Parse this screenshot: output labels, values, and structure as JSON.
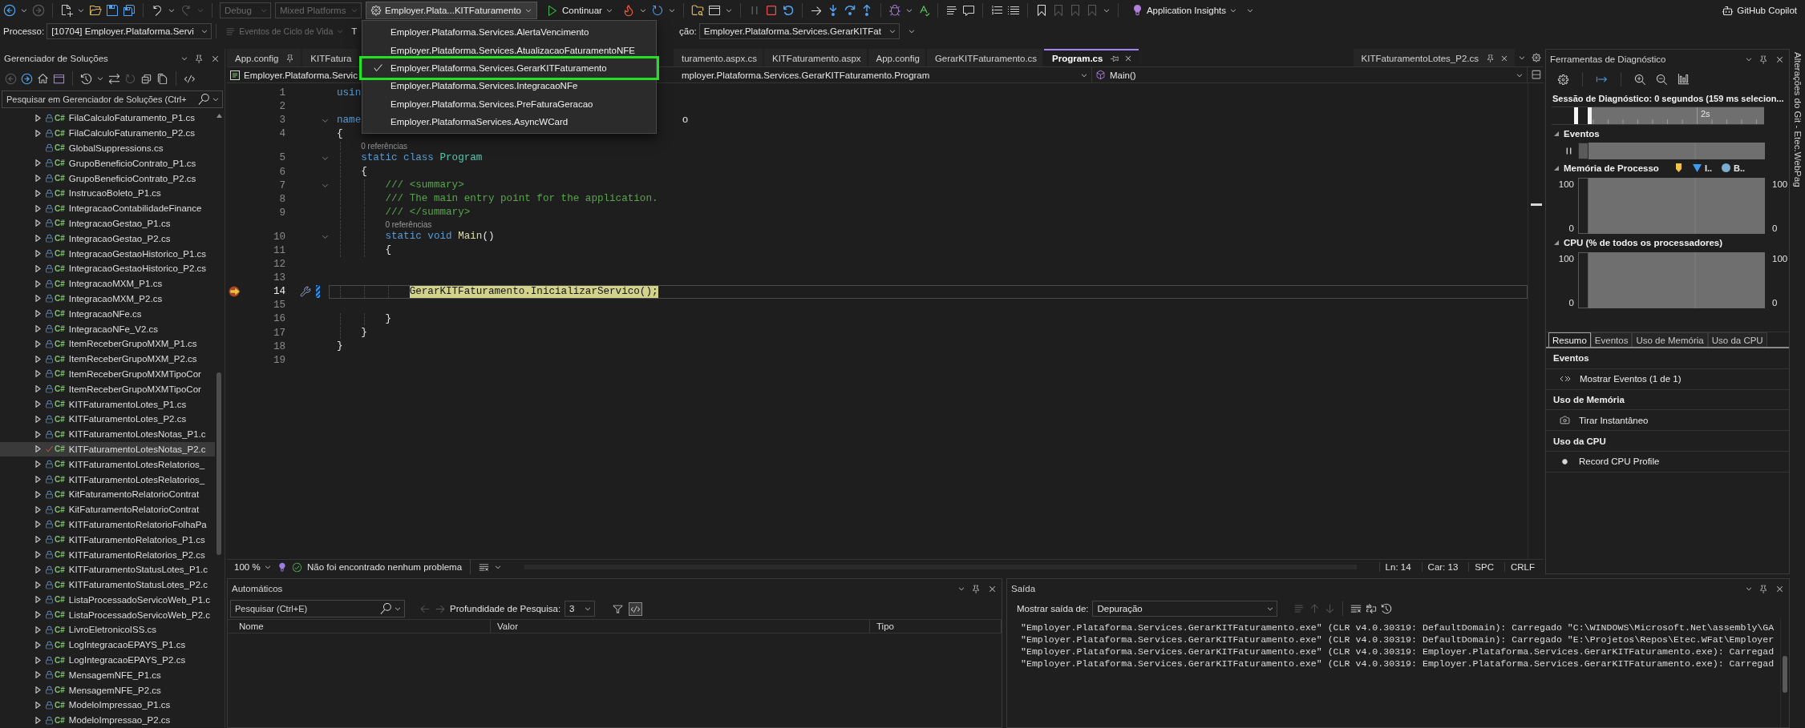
{
  "toolbar": {
    "navigation": [
      {
        "disabled": false
      },
      {
        "disabled": true
      }
    ],
    "history": [
      {
        "disabled": false
      },
      {
        "disabled": true
      }
    ],
    "configuration": {
      "value": "Debug",
      "disabled": true
    },
    "platform": {
      "value": "Mixed Platforms",
      "disabled": true
    },
    "startup_item": {
      "label": "Employer.Plata...KITFaturamento",
      "expanded": true
    },
    "continue_button": {
      "label": "Continuar"
    },
    "execution": [
      {
        "disabled": true
      },
      {
        "disabled": false
      },
      {
        "disabled": false
      }
    ],
    "bookmarks": [
      {
        "disabled": false
      },
      {
        "disabled": true
      },
      {
        "disabled": true
      },
      {
        "disabled": true
      }
    ],
    "insights_button": {
      "label": "Application Insights"
    },
    "copilot_button": {
      "label": "GitHub Copilot"
    }
  },
  "debug_location": {
    "process_label": "Processo:",
    "process": "[10704] Employer.Plataforma.Servi",
    "lifecycle_events": {
      "label": "Eventos de Ciclo de Vida",
      "disabled": true
    },
    "thread_label": "T",
    "frame_label": "ção:",
    "frame": "Employer.Plataforma.Services.GerarKITFat"
  },
  "startup_menu": [
    {
      "label": "Employer.Plataforma.Services.AlertaVencimento",
      "selected": false,
      "highlighted": false
    },
    {
      "label": "Employer.Plataforma.Services.AtualizacaoFaturamentoNFE",
      "selected": false,
      "highlighted": false
    },
    {
      "label": "Employer.Plataforma.Services.GerarKITFaturamento",
      "selected": true,
      "highlighted": true
    },
    {
      "label": "Employer.Plataforma.Services.IntegracaoNFe",
      "selected": false,
      "highlighted": false
    },
    {
      "label": "Employer.Plataforma.Services.PreFaturaGeracao",
      "selected": false,
      "highlighted": false
    },
    {
      "label": "Employer.PlataformaServices.AsyncWCard",
      "selected": false,
      "highlighted": false
    }
  ],
  "solution_explorer": {
    "title": "Gerenciador de Soluções",
    "toolbar": [
      {
        "disabled": true
      },
      {
        "disabled": false
      },
      {
        "disabled": false
      },
      {
        "disabled": false
      },
      {
        "disabled": false
      },
      {
        "disabled": false
      },
      {
        "disabled": true
      },
      {
        "disabled": false
      },
      {
        "disabled": false
      },
      {
        "disabled": false
      }
    ],
    "search": {
      "placeholder": "Pesquisar em Gerenciador de Soluções (Ctrl+"
    },
    "items": [
      {
        "name": "FilaCalculoFaturamento_P1.cs",
        "badge": "C#",
        "expandable": true,
        "edited": false,
        "selected": false
      },
      {
        "name": "FilaCalculoFaturamento_P2.cs",
        "badge": "C#",
        "expandable": true,
        "edited": false,
        "selected": false
      },
      {
        "name": "GlobalSuppressions.cs",
        "badge": "C#",
        "expandable": false,
        "edited": false,
        "selected": false
      },
      {
        "name": "GrupoBeneficioContrato_P1.cs",
        "badge": "C#",
        "expandable": true,
        "edited": false,
        "selected": false
      },
      {
        "name": "GrupoBeneficioContrato_P2.cs",
        "badge": "C#",
        "expandable": true,
        "edited": false,
        "selected": false
      },
      {
        "name": "InstrucaoBoleto_P1.cs",
        "badge": "C#",
        "expandable": true,
        "edited": false,
        "selected": false
      },
      {
        "name": "IntegracaoContabilidadeFinance",
        "badge": "C#",
        "expandable": true,
        "edited": false,
        "selected": false
      },
      {
        "name": "IntegracaoGestao_P1.cs",
        "badge": "C#",
        "expandable": true,
        "edited": false,
        "selected": false
      },
      {
        "name": "IntegracaoGestao_P2.cs",
        "badge": "C#",
        "expandable": true,
        "edited": false,
        "selected": false
      },
      {
        "name": "IntegracaoGestaoHistorico_P1.cs",
        "badge": "C#",
        "expandable": true,
        "edited": false,
        "selected": false
      },
      {
        "name": "IntegracaoGestaoHistorico_P2.cs",
        "badge": "C#",
        "expandable": true,
        "edited": false,
        "selected": false
      },
      {
        "name": "IntegracaoMXM_P1.cs",
        "badge": "C#",
        "expandable": true,
        "edited": false,
        "selected": false
      },
      {
        "name": "IntegracaoMXM_P2.cs",
        "badge": "C#",
        "expandable": true,
        "edited": false,
        "selected": false
      },
      {
        "name": "IntegracaoNFe.cs",
        "badge": "C#",
        "expandable": true,
        "edited": false,
        "selected": false
      },
      {
        "name": "IntegracaoNFe_V2.cs",
        "badge": "C#",
        "expandable": true,
        "edited": false,
        "selected": false
      },
      {
        "name": "ItemReceberGrupoMXM_P1.cs",
        "badge": "C#",
        "expandable": true,
        "edited": false,
        "selected": false
      },
      {
        "name": "ItemReceberGrupoMXM_P2.cs",
        "badge": "C#",
        "expandable": true,
        "edited": false,
        "selected": false
      },
      {
        "name": "ItemReceberGrupoMXMTipoCor",
        "badge": "C#",
        "expandable": true,
        "edited": false,
        "selected": false
      },
      {
        "name": "ItemReceberGrupoMXMTipoCor",
        "badge": "C#",
        "expandable": true,
        "edited": false,
        "selected": false
      },
      {
        "name": "KITFaturamentoLotes_P1.cs",
        "badge": "C#",
        "expandable": true,
        "edited": false,
        "selected": false
      },
      {
        "name": "KITFaturamentoLotes_P2.cs",
        "badge": "C#",
        "expandable": true,
        "edited": false,
        "selected": false
      },
      {
        "name": "KITFaturamentoLotesNotas_P1.c",
        "badge": "C#",
        "expandable": true,
        "edited": false,
        "selected": false
      },
      {
        "name": "KITFaturamentoLotesNotas_P2.c",
        "badge": "C#",
        "expandable": true,
        "edited": true,
        "selected": true
      },
      {
        "name": "KITFaturamentoLotesRelatorios_",
        "badge": "C#",
        "expandable": true,
        "edited": false,
        "selected": false
      },
      {
        "name": "KITFaturamentoLotesRelatorios_",
        "badge": "C#",
        "expandable": true,
        "edited": false,
        "selected": false
      },
      {
        "name": "KitFaturamentoRelatorioContrat",
        "badge": "C#",
        "expandable": true,
        "edited": false,
        "selected": false
      },
      {
        "name": "KitFaturamentoRelatorioContrat",
        "badge": "C#",
        "expandable": true,
        "edited": false,
        "selected": false
      },
      {
        "name": "KITFaturamentoRelatorioFolhaPa",
        "badge": "C#",
        "expandable": true,
        "edited": false,
        "selected": false
      },
      {
        "name": "KITFaturamentoRelatorios_P1.cs",
        "badge": "C#",
        "expandable": true,
        "edited": false,
        "selected": false
      },
      {
        "name": "KITFaturamentoRelatorios_P2.cs",
        "badge": "C#",
        "expandable": true,
        "edited": false,
        "selected": false
      },
      {
        "name": "KITFaturamentoStatusLotes_P1.c",
        "badge": "C#",
        "expandable": true,
        "edited": false,
        "selected": false
      },
      {
        "name": "KITFaturamentoStatusLotes_P2.c",
        "badge": "C#",
        "expandable": true,
        "edited": false,
        "selected": false
      },
      {
        "name": "ListaProcessadoServicoWeb_P1.c",
        "badge": "C#",
        "expandable": true,
        "edited": false,
        "selected": false
      },
      {
        "name": "ListaProcessadoServicoWeb_P2.c",
        "badge": "C#",
        "expandable": true,
        "edited": false,
        "selected": false
      },
      {
        "name": "LivroEletronicoISS.cs",
        "badge": "C#",
        "expandable": true,
        "edited": false,
        "selected": false
      },
      {
        "name": "LogIntegracaoEPAYS_P1.cs",
        "badge": "C#",
        "expandable": true,
        "edited": false,
        "selected": false
      },
      {
        "name": "LogIntegracaoEPAYS_P2.cs",
        "badge": "C#",
        "expandable": true,
        "edited": false,
        "selected": false
      },
      {
        "name": "MensagemNFE_P1.cs",
        "badge": "C#",
        "expandable": true,
        "edited": false,
        "selected": false
      },
      {
        "name": "MensagemNFE_P2.cs",
        "badge": "C#",
        "expandable": true,
        "edited": false,
        "selected": false
      },
      {
        "name": "ModeloImpressao_P1.cs",
        "badge": "C#",
        "expandable": true,
        "edited": false,
        "selected": false
      },
      {
        "name": "ModeloImpressao_P2.cs",
        "badge": "C#",
        "expandable": true,
        "edited": false,
        "selected": false
      }
    ]
  },
  "editor": {
    "tabs": [
      {
        "label": "App.config",
        "pinned": true,
        "selected": false
      },
      {
        "label": "KITFatura",
        "pinned": false,
        "selected": false
      },
      {
        "label": "turamento.aspx.cs",
        "pinned": false,
        "selected": false
      },
      {
        "label": "KITFaturamento.aspx",
        "pinned": false,
        "selected": false
      },
      {
        "label": "App.config",
        "pinned": false,
        "selected": false
      },
      {
        "label": "GerarKITFaturamento.cs",
        "pinned": false,
        "selected": false
      },
      {
        "label": "Program.cs",
        "pinned": false,
        "selected": true
      }
    ],
    "right_tabs": [
      {
        "label": "KITFaturamentoLotes_P2.cs",
        "pinned": true,
        "selected": false
      }
    ],
    "navigation": {
      "project": "Employer.Plataforma.Servic",
      "type": "mployer.Plataforma.Services.GerarKITFaturamento.Program",
      "member": "Main()"
    },
    "lines": [
      {
        "number": "1",
        "tokens": [
          {
            "text": "usin",
            "kind": "keyword"
          }
        ],
        "foldable": false,
        "current": false,
        "changed": false
      },
      {
        "number": "2",
        "foldable": false,
        "current": false,
        "changed": false
      },
      {
        "number": "3",
        "tokens": [
          {
            "text": "name",
            "kind": "keyword"
          }
        ],
        "tail": [
          {
            "text": "o",
            "kind": "plain"
          }
        ],
        "foldable": true,
        "current": false,
        "changed": false
      },
      {
        "number": "4",
        "tokens": [
          {
            "text": "{",
            "kind": "plain"
          }
        ],
        "foldable": false,
        "current": false,
        "changed": false
      },
      {
        "number": "5",
        "codelens": "    0 referências",
        "tokens": [
          {
            "text": "    static class",
            "kind": "keyword"
          },
          {
            "text": " Program",
            "kind": "type"
          }
        ],
        "foldable": true,
        "current": false,
        "changed": false
      },
      {
        "number": "6",
        "tokens": [
          {
            "text": "    {",
            "kind": "plain"
          }
        ],
        "foldable": false,
        "current": false,
        "changed": false
      },
      {
        "number": "7",
        "tokens": [
          {
            "text": "        /// <summary>",
            "kind": "comment"
          }
        ],
        "foldable": true,
        "current": false,
        "changed": false
      },
      {
        "number": "8",
        "tokens": [
          {
            "text": "        /// The main entry point for the application.",
            "kind": "comment"
          }
        ],
        "foldable": false,
        "current": false,
        "changed": false
      },
      {
        "number": "9",
        "tokens": [
          {
            "text": "        /// </summary>",
            "kind": "comment"
          }
        ],
        "foldable": false,
        "current": false,
        "changed": false
      },
      {
        "number": "10",
        "codelens": "        0 referências",
        "tokens": [
          {
            "text": "        static void",
            "kind": "keyword"
          },
          {
            "text": " Main",
            "kind": "method"
          },
          {
            "text": "()",
            "kind": "plain"
          }
        ],
        "foldable": true,
        "current": false,
        "changed": false
      },
      {
        "number": "11",
        "tokens": [
          {
            "text": "        {",
            "kind": "plain"
          }
        ],
        "foldable": false,
        "current": false,
        "changed": false
      },
      {
        "number": "12",
        "foldable": false,
        "current": false,
        "changed": false
      },
      {
        "number": "13",
        "foldable": false,
        "current": false,
        "changed": false
      },
      {
        "number": "14",
        "tokens": [
          {
            "text": "            GerarKITFaturamento.InicializarServico();",
            "kind": "plain"
          }
        ],
        "foldable": false,
        "current": true,
        "changed": true
      },
      {
        "number": "15",
        "foldable": false,
        "current": false,
        "changed": false
      },
      {
        "number": "16",
        "tokens": [
          {
            "text": "        }",
            "kind": "plain"
          }
        ],
        "foldable": false,
        "current": false,
        "changed": false
      },
      {
        "number": "17",
        "tokens": [
          {
            "text": "    }",
            "kind": "plain"
          }
        ],
        "foldable": false,
        "current": false,
        "changed": false
      },
      {
        "number": "18",
        "tokens": [
          {
            "text": "}",
            "kind": "plain"
          }
        ],
        "foldable": false,
        "current": false,
        "changed": false
      },
      {
        "number": "19",
        "foldable": false,
        "current": false,
        "changed": false
      }
    ],
    "status": {
      "zoom": "100 %",
      "issues": "Não foi encontrado nenhum problema",
      "line": "Ln: 14",
      "column": "Car: 13",
      "indentation": "SPC",
      "line_ending": "CRLF"
    }
  },
  "diagnostics": {
    "title": "Ferramentas de Diagnóstico",
    "session": "Sessão de Diagnóstico: 0 segundos (159 ms selecion...",
    "ruler_label": "2s",
    "events": {
      "title": "Eventos"
    },
    "memory": {
      "title": "Memória de Processo",
      "legend": [
        {
          "kind": "marker",
          "color": "#f0c24a"
        },
        {
          "kind": "triangle",
          "label": "I..",
          "color": "#3c9ded"
        },
        {
          "kind": "circle",
          "label": "B..",
          "color": "#7aaed0"
        }
      ],
      "left_ticks": [
        "100",
        "0"
      ],
      "right_ticks": [
        "100",
        "0"
      ]
    },
    "cpu": {
      "title": "CPU (% de todos os processadores)",
      "left_ticks": [
        "100",
        "0"
      ],
      "right_ticks": [
        "100",
        "0"
      ]
    },
    "tabs": [
      {
        "label": "Resumo",
        "selected": true
      },
      {
        "label": "Eventos",
        "selected": false
      },
      {
        "label": "Uso de Memória",
        "selected": false
      },
      {
        "label": "Uso da CPU",
        "selected": false
      }
    ],
    "summary": [
      {
        "title": "Eventos",
        "action": "Mostrar Eventos (1 de 1)"
      },
      {
        "title": "Uso de Memória",
        "action": "Tirar Instantâneo"
      },
      {
        "title": "Uso da CPU",
        "action": "Record CPU Profile"
      }
    ]
  },
  "autos": {
    "title": "Automáticos",
    "search": {
      "placeholder": "Pesquisar (Ctrl+E)"
    },
    "history": [
      {
        "disabled": true
      },
      {
        "disabled": true
      }
    ],
    "depth_label": "Profundidade de Pesquisa:",
    "depth": "3",
    "toggles": [
      {
        "on": false
      },
      {
        "on": true
      }
    ],
    "columns": [
      "Nome",
      "Valor",
      "Tipo"
    ]
  },
  "output": {
    "title": "Saída",
    "source_label": "Mostrar saída de:",
    "source": "Depuração",
    "toolbar": [
      {
        "disabled": true
      },
      {
        "disabled": true
      },
      {
        "disabled": true
      },
      {
        "disabled": false
      },
      {
        "disabled": false
      },
      {
        "disabled": false
      }
    ],
    "lines": [
      "\"Employer.Plataforma.Services.GerarKITFaturamento.exe\" (CLR v4.0.30319: DefaultDomain): Carregado \"C:\\WINDOWS\\Microsoft.Net\\assembly\\GA",
      "\"Employer.Plataforma.Services.GerarKITFaturamento.exe\" (CLR v4.0.30319: DefaultDomain): Carregado \"E:\\Projetos\\Repos\\Etec.WFat\\Employer",
      "\"Employer.Plataforma.Services.GerarKITFaturamento.exe\" (CLR v4.0.30319: Employer.Plataforma.Services.GerarKITFaturamento.exe): Carregad",
      "\"Employer.Plataforma.Services.GerarKITFaturamento.exe\" (CLR v4.0.30319: Employer.Plataforma.Services.GerarKITFaturamento.exe): Carregad"
    ]
  },
  "side_tab": {
    "label": "Alterações do Git - Etec.WebPag"
  }
}
